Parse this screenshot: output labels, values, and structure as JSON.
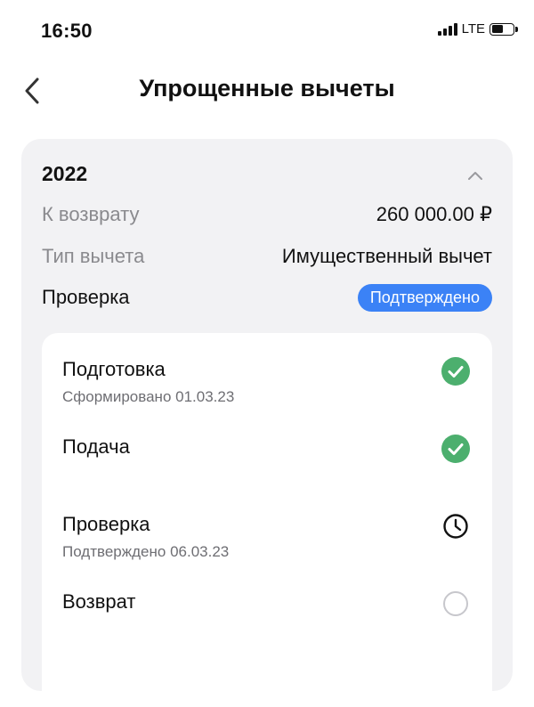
{
  "status_bar": {
    "time": "16:50",
    "network": "LTE",
    "battery_level": 0.55
  },
  "header": {
    "title": "Упрощенные вычеты",
    "back_icon": "chevron-left-icon"
  },
  "card": {
    "year": "2022",
    "collapse_icon": "chevron-up-icon",
    "rows": {
      "refund_label": "К возврату",
      "refund_value": "260 000.00 ₽",
      "type_label": "Тип вычета",
      "type_value": "Имущественный вычет",
      "check_label": "Проверка",
      "check_status": "Подтверждено"
    },
    "badge_color": "#3b82f6"
  },
  "steps": [
    {
      "title": "Подготовка",
      "subtitle": "Сформировано 01.03.23",
      "status": "done",
      "icon": "check-circle-icon"
    },
    {
      "title": "Подача",
      "subtitle": "",
      "status": "done",
      "icon": "check-circle-icon"
    },
    {
      "title": "Проверка",
      "subtitle": "Подтверждено 06.03.23",
      "status": "in-progress",
      "icon": "clock-icon"
    },
    {
      "title": "Возврат",
      "subtitle": "",
      "status": "pending",
      "icon": "empty-circle-icon"
    }
  ],
  "colors": {
    "done": "#4caf6e",
    "card_bg": "#f2f2f4",
    "muted_text": "#8a8a8e"
  }
}
